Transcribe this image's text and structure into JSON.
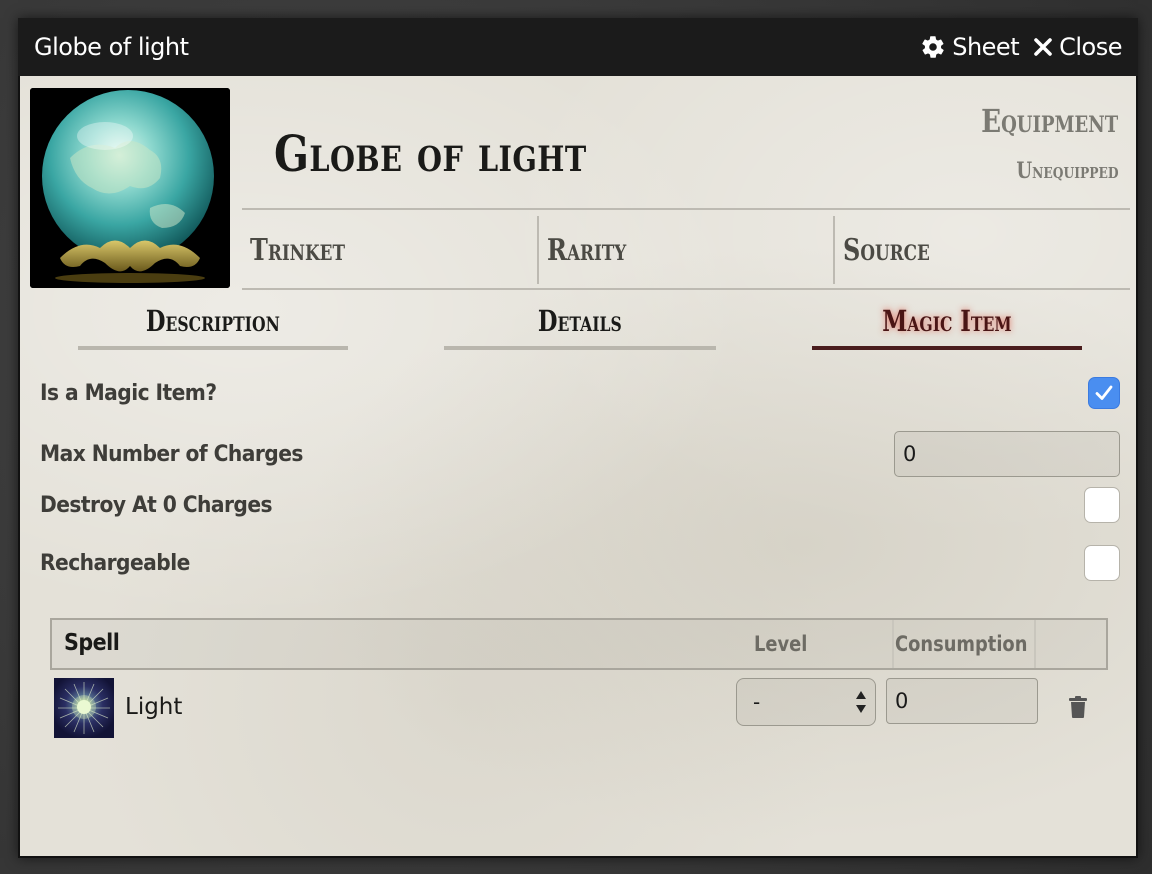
{
  "window": {
    "title": "Globe of light",
    "sheet_label": "Sheet",
    "close_label": "Close"
  },
  "item": {
    "name": "Globe of light",
    "type": "Equipment",
    "status": "Unequipped",
    "summary": [
      "Trinket",
      "Rarity",
      "Source"
    ]
  },
  "tabs": [
    {
      "label": "Description",
      "active": false
    },
    {
      "label": "Details",
      "active": false
    },
    {
      "label": "Magic Item",
      "active": true
    }
  ],
  "form": {
    "is_magic_label": "Is a Magic Item?",
    "is_magic_checked": true,
    "max_charges_label": "Max Number of Charges",
    "max_charges_value": "0",
    "destroy_label": "Destroy At 0 Charges",
    "destroy_checked": false,
    "rechargeable_label": "Rechargeable",
    "rechargeable_checked": false
  },
  "spells": {
    "header_spell": "Spell",
    "header_level": "Level",
    "header_consumption": "Consumption",
    "rows": [
      {
        "name": "Light",
        "level": "-",
        "consumption": "0"
      }
    ]
  },
  "colors": {
    "accent_tab": "#4a1d1d",
    "checkbox_checked": "#4a8ef0",
    "parchment": "#e4e1d8"
  }
}
